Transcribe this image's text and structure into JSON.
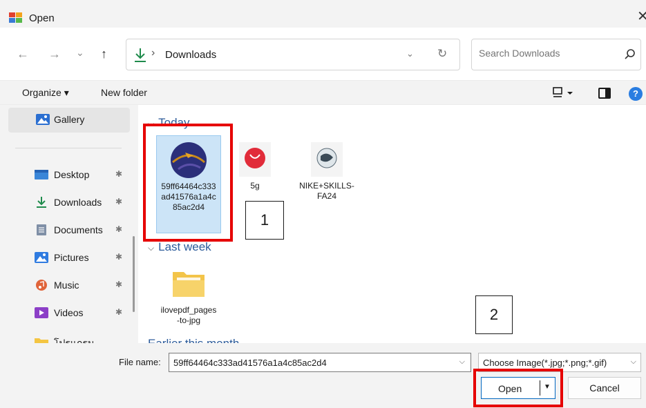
{
  "window": {
    "title": "Open",
    "close_glyph": "✕"
  },
  "nav": {
    "back_glyph": "←",
    "forward_glyph": "→",
    "recent_glyph": "⌄",
    "up_glyph": "↑",
    "address_separator": "›",
    "breadcrumb": "Downloads",
    "address_dropdown_glyph": "⌄",
    "refresh_glyph": "↻",
    "search_placeholder": "Search Downloads"
  },
  "command_bar": {
    "organize_label": "Organize ▾",
    "new_folder_label": "New folder",
    "help_glyph": "?"
  },
  "sidebar": {
    "items": [
      {
        "label": "Gallery",
        "icon": "gallery-icon",
        "pinned": false
      },
      {
        "label": "Desktop",
        "icon": "desktop-icon",
        "pinned": true
      },
      {
        "label": "Downloads",
        "icon": "downloads-icon",
        "pinned": true
      },
      {
        "label": "Documents",
        "icon": "documents-icon",
        "pinned": true
      },
      {
        "label": "Pictures",
        "icon": "pictures-icon",
        "pinned": true
      },
      {
        "label": "Music",
        "icon": "music-icon",
        "pinned": true
      },
      {
        "label": "Videos",
        "icon": "videos-icon",
        "pinned": true
      },
      {
        "label": "โปรแกรม",
        "icon": "folder-icon",
        "pinned": false
      }
    ]
  },
  "content": {
    "groups": [
      {
        "header": "Today"
      },
      {
        "header": "Last week"
      },
      {
        "header": "Earlier this month"
      }
    ],
    "files": [
      {
        "name": "59ff64464c333ad41576a1a4c85ac2d4",
        "selected": true
      },
      {
        "name": "5g",
        "selected": false
      },
      {
        "name": "NIKE+SKILLS-FA24",
        "selected": false
      },
      {
        "name": "ilovepdf_pages-to-jpg",
        "selected": false
      }
    ]
  },
  "footer": {
    "filename_label": "File name:",
    "filename_value": "59ff64464c333ad41576a1a4c85ac2d4",
    "filetype_value": "Choose Image(*.jpg;*.png;*.gif)",
    "open_label": "Open",
    "cancel_label": "Cancel"
  },
  "annotations": {
    "marker_1": "1",
    "marker_2": "2"
  },
  "colors": {
    "highlight": "#e60000",
    "selection": "#cce4f7",
    "accent": "#0067c0"
  }
}
